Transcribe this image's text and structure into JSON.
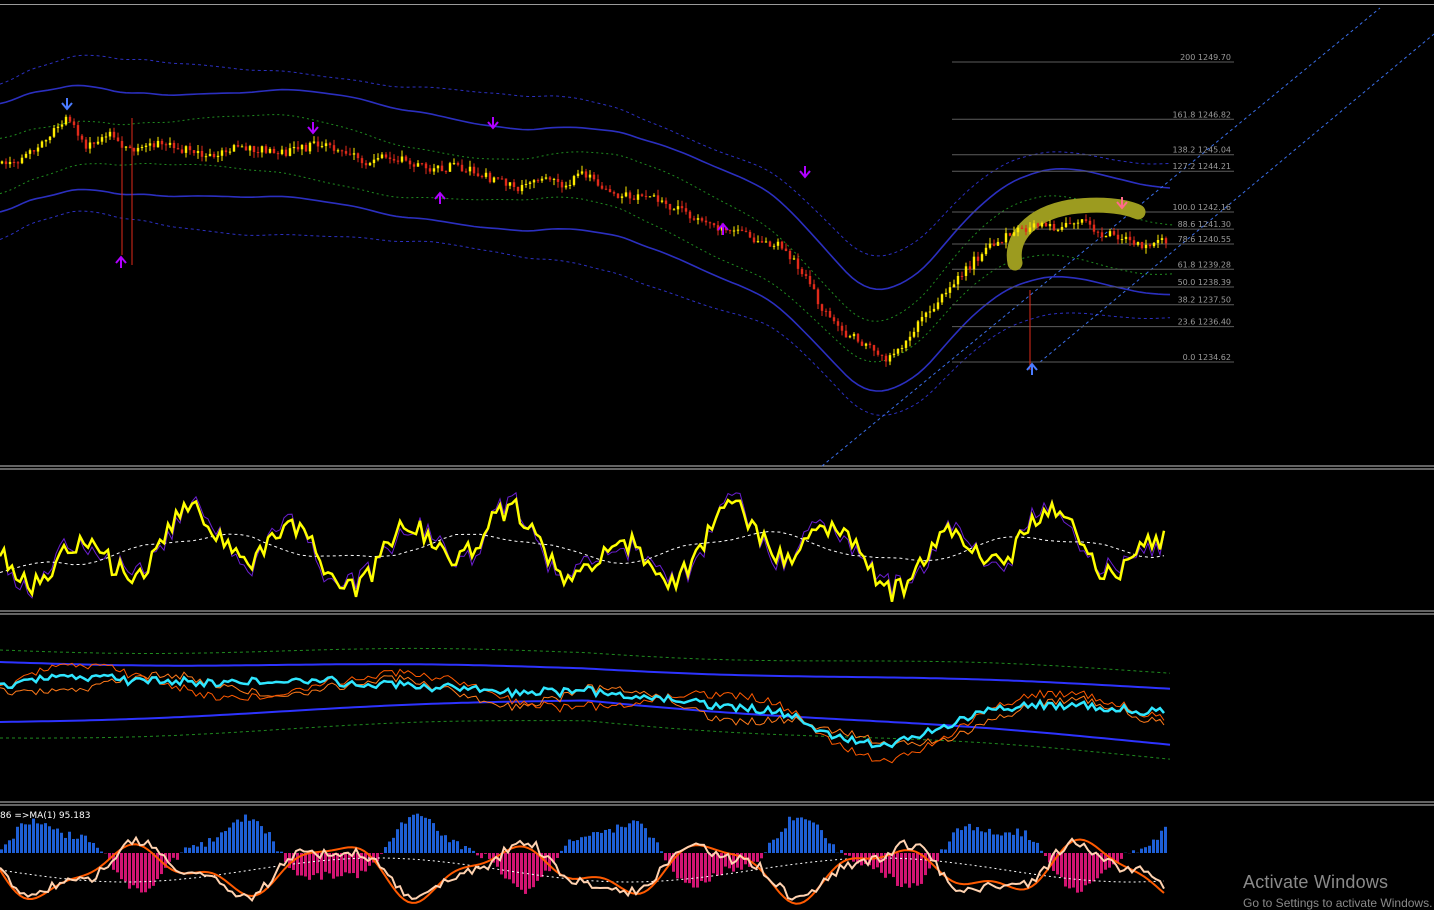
{
  "colors": {
    "background": "#000000",
    "separator": "#c8c8c8",
    "candle_up": "#ffeb00",
    "candle_down": "#e02a1a",
    "band_blue": "#2b2fbf",
    "band_green": "#1f8a1f",
    "trend_line": "#3a6ee8",
    "rsi_line": "#ffff00",
    "rsi_purple": "#6a1fd0",
    "price_cyan": "#2fe6ff",
    "hist_up": "#1e5fd6",
    "hist_down": "#d21472",
    "orange_line": "#ff7a1a",
    "highlight": "#9c9b1f"
  },
  "icons": [
    "arrow-up-icon",
    "arrow-down-icon"
  ],
  "main_chart": {
    "fib_levels": [
      {
        "ratio": "200",
        "price": "1249.70",
        "label": "200 1249.70"
      },
      {
        "ratio": "161.8",
        "price": "1246.82",
        "label": "161.8 1246.82"
      },
      {
        "ratio": "138.2",
        "price": "1245.04",
        "label": "138.2 1245.04"
      },
      {
        "ratio": "127.2",
        "price": "1244.21",
        "label": "127.2 1244.21"
      },
      {
        "ratio": "100.0",
        "price": "1242.16",
        "label": "100.0 1242.16"
      },
      {
        "ratio": "88.6",
        "price": "1241.30",
        "label": "88.6 1241.30"
      },
      {
        "ratio": "78.6",
        "price": "1240.55",
        "label": "78.6 1240.55"
      },
      {
        "ratio": "61.8",
        "price": "1239.28",
        "label": "61.8 1239.28"
      },
      {
        "ratio": "50.0",
        "price": "1238.39",
        "label": "50.0 1238.39"
      },
      {
        "ratio": "38.2",
        "price": "1237.50",
        "label": "38.2 1237.50"
      },
      {
        "ratio": "23.6",
        "price": "1236.40",
        "label": "23.6 1236.40"
      },
      {
        "ratio": "0.0",
        "price": "1234.62",
        "label": "0.0 1234.62"
      }
    ]
  },
  "histogram_panel": {
    "label": "86  =>MA(1) 95.183"
  },
  "watermark": {
    "title": "Activate Windows",
    "subtitle": "Go to Settings to activate Windows."
  },
  "chart_data": {
    "type": "line",
    "fib_price_range": [
      1234.62,
      1249.7
    ],
    "fib_levels": [
      1249.7,
      1246.82,
      1245.04,
      1244.21,
      1242.16,
      1241.3,
      1240.55,
      1239.28,
      1238.39,
      1237.5,
      1236.4,
      1234.62
    ],
    "price_path": [
      1244.6,
      1244.9,
      1245.8,
      1246.9,
      1245.4,
      1246.0,
      1245.2,
      1245.6,
      1245.4,
      1245.2,
      1245.0,
      1245.5,
      1245.3,
      1245.1,
      1245.4,
      1245.6,
      1245.0,
      1244.7,
      1244.9,
      1244.6,
      1244.2,
      1244.5,
      1244.1,
      1243.7,
      1243.4,
      1243.8,
      1243.5,
      1244.1,
      1243.2,
      1243.0,
      1242.9,
      1242.4,
      1242.0,
      1241.4,
      1241.1,
      1240.8,
      1240.5,
      1239.4,
      1237.4,
      1236.1,
      1235.6,
      1234.7,
      1235.8,
      1237.2,
      1238.4,
      1239.6,
      1240.6,
      1241.1,
      1241.5,
      1241.3,
      1241.7,
      1241.1,
      1240.9,
      1240.4,
      1240.8
    ],
    "signal_arrows": [
      {
        "index": 6,
        "direction": "down"
      },
      {
        "index": 10,
        "direction": "up"
      },
      {
        "index": 21,
        "direction": "down"
      },
      {
        "index": 29,
        "direction": "up"
      },
      {
        "index": 32,
        "direction": "down"
      },
      {
        "index": 48,
        "direction": "up"
      },
      {
        "index": 54,
        "direction": "down"
      },
      {
        "index": 71,
        "direction": "up"
      },
      {
        "index": 77,
        "direction": "down"
      }
    ]
  }
}
